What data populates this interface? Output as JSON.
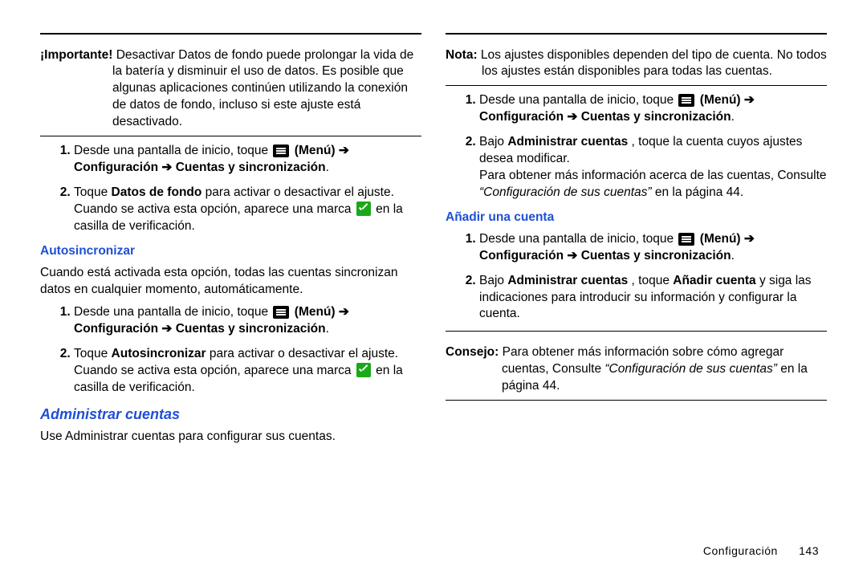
{
  "left": {
    "important": {
      "label": "¡Importante!",
      "text": "Desactivar Datos de fondo puede prolongar la vida de la batería y disminuir el uso de datos. Es posible que algunas aplicaciones continúen utilizando la conexión de datos de fondo, incluso si este ajuste está desactivado."
    },
    "steps1": {
      "s1a": "Desde una pantalla de inicio, toque ",
      "s1b": "(Menú)",
      "arrow": "➔",
      "s1c": "Configuración",
      "s1d": "Cuentas y sincronización",
      "s2a": "Toque ",
      "s2b": "Datos de fondo",
      "s2c": " para activar o desactivar el ajuste. Cuando se activa esta opción, aparece una marca ",
      "s2d": " en la casilla de verificación."
    },
    "autosync": {
      "title": "Autosincronizar",
      "intro": "Cuando está activada esta opción, todas las cuentas sincronizan datos en cualquier momento, automáticamente.",
      "s2a": "Toque ",
      "s2b": "Autosincronizar",
      "s2c": " para activar o desactivar el ajuste. Cuando se activa esta opción, aparece una marca ",
      "s2d": " en la casilla de verificación."
    },
    "manage": {
      "title": "Administrar cuentas",
      "intro": "Use Administrar cuentas para configurar sus cuentas."
    }
  },
  "right": {
    "note": {
      "label": "Nota:",
      "text": "Los ajustes disponibles dependen del tipo de cuenta. No todos los ajustes están disponibles para todas las cuentas."
    },
    "steps1": {
      "s2a": "Bajo ",
      "s2b": "Administrar cuentas",
      "s2c": ", toque la cuenta cuyos ajustes desea modificar.",
      "s2d": "Para obtener más información acerca de las cuentas, Consulte ",
      "s2e": "“Configuración de sus cuentas”",
      "s2f": " en la página 44."
    },
    "add": {
      "title": "Añadir una cuenta",
      "s2a": "Bajo ",
      "s2b": "Administrar cuentas",
      "s2c": ", toque ",
      "s2d": "Añadir cuenta",
      "s2e": " y siga las indicaciones para introducir su información y configurar la cuenta."
    },
    "tip": {
      "label": "Consejo:",
      "text1": "Para obtener más información sobre cómo agregar cuentas, Consulte ",
      "text2": "“Configuración de sus cuentas”",
      "text3": " en la página 44."
    }
  },
  "footer": {
    "section": "Configuración",
    "page": "143"
  }
}
